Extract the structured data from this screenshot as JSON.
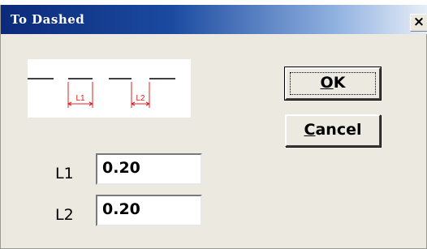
{
  "window": {
    "title": "To Dashed",
    "close_label": "×"
  },
  "preview": {
    "label_l1": "L1",
    "label_l2": "L2",
    "dash_color": "#000000",
    "dimension_color": "#e02020"
  },
  "buttons": {
    "ok_accel": "O",
    "ok_rest": "K",
    "cancel_accel": "C",
    "cancel_rest": "ancel"
  },
  "fields": {
    "l1_label": "L1",
    "l1_value": "0.20",
    "l2_label": "L2",
    "l2_value": "0.20"
  },
  "colors": {
    "title_gradient_start": "#0c2a7a",
    "title_gradient_end": "#e8eef8",
    "dialog_background": "#ece9e1"
  }
}
